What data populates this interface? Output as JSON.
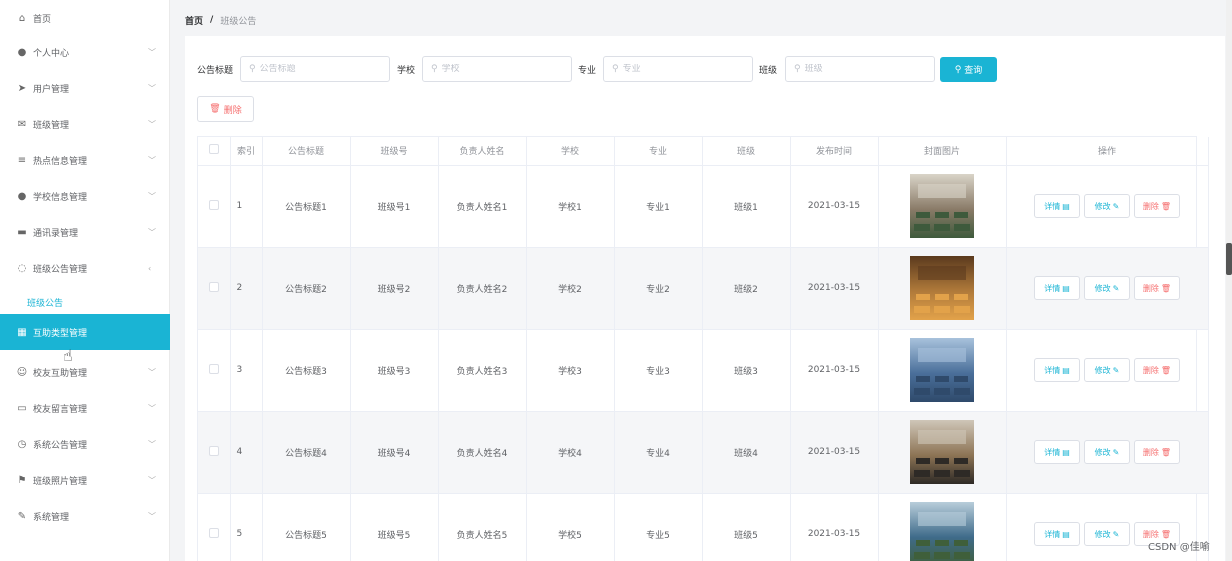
{
  "sidebar": {
    "items": [
      {
        "label": "首页",
        "icon": "home-icon",
        "glyph": "⌂",
        "chevron": ""
      },
      {
        "label": "个人中心",
        "icon": "user-icon",
        "glyph": "●",
        "chevron": "﹀"
      },
      {
        "label": "用户管理",
        "icon": "send-icon",
        "glyph": "➤",
        "chevron": "﹀"
      },
      {
        "label": "班级管理",
        "icon": "mail-icon",
        "glyph": "✉",
        "chevron": "﹀"
      },
      {
        "label": "热点信息管理",
        "icon": "menu-icon",
        "glyph": "≡",
        "chevron": "﹀"
      },
      {
        "label": "学校信息管理",
        "icon": "user-icon",
        "glyph": "●",
        "chevron": "﹀"
      },
      {
        "label": "通讯录管理",
        "icon": "printer-icon",
        "glyph": "▬",
        "chevron": "﹀"
      },
      {
        "label": "班级公告管理",
        "icon": "power-icon",
        "glyph": "◌",
        "chevron": "‹"
      },
      {
        "label": "互助类型管理",
        "icon": "grid-icon",
        "glyph": "▦",
        "chevron": ""
      },
      {
        "label": "校友互助管理",
        "icon": "smile-icon",
        "glyph": "☺",
        "chevron": "﹀"
      },
      {
        "label": "校友留言管理",
        "icon": "message-icon",
        "glyph": "▭",
        "chevron": "﹀"
      },
      {
        "label": "系统公告管理",
        "icon": "compass-icon",
        "glyph": "◷",
        "chevron": "﹀"
      },
      {
        "label": "班级照片管理",
        "icon": "flag-icon",
        "glyph": "⚑",
        "chevron": "﹀"
      },
      {
        "label": "系统管理",
        "icon": "edit-icon",
        "glyph": "✎",
        "chevron": "﹀"
      }
    ],
    "sub_item": "班级公告"
  },
  "breadcrumb": {
    "home": "首页",
    "sep": "/",
    "current": "班级公告"
  },
  "search": {
    "title_label": "公告标题",
    "title_placeholder": "公告标题",
    "school_label": "学校",
    "school_placeholder": "学校",
    "major_label": "专业",
    "major_placeholder": "专业",
    "class_label": "班级",
    "class_placeholder": "班级",
    "query_label": "查询"
  },
  "toolbar": {
    "delete_label": "删除"
  },
  "table": {
    "headers": [
      "索引",
      "公告标题",
      "班级号",
      "负责人姓名",
      "学校",
      "专业",
      "班级",
      "发布时间",
      "封面图片",
      "操作"
    ],
    "rows": [
      {
        "index": "1",
        "title": "公告标题1",
        "class_no": "班级号1",
        "owner": "负责人姓名1",
        "school": "学校1",
        "major": "专业1",
        "class": "班级1",
        "date": "2021-03-15"
      },
      {
        "index": "2",
        "title": "公告标题2",
        "class_no": "班级号2",
        "owner": "负责人姓名2",
        "school": "学校2",
        "major": "专业2",
        "class": "班级2",
        "date": "2021-03-15"
      },
      {
        "index": "3",
        "title": "公告标题3",
        "class_no": "班级号3",
        "owner": "负责人姓名3",
        "school": "学校3",
        "major": "专业3",
        "class": "班级3",
        "date": "2021-03-15"
      },
      {
        "index": "4",
        "title": "公告标题4",
        "class_no": "班级号4",
        "owner": "负责人姓名4",
        "school": "学校4",
        "major": "专业4",
        "class": "班级4",
        "date": "2021-03-15"
      },
      {
        "index": "5",
        "title": "公告标题5",
        "class_no": "班级号5",
        "owner": "负责人姓名5",
        "school": "学校5",
        "major": "专业5",
        "class": "班级5",
        "date": "2021-03-15"
      }
    ],
    "actions": {
      "detail": "详情",
      "edit": "修改",
      "delete": "删除"
    }
  },
  "colors": {
    "accent": "#1ab4d4",
    "danger": "#f56c6c"
  },
  "watermark": "CSDN @佳喻"
}
